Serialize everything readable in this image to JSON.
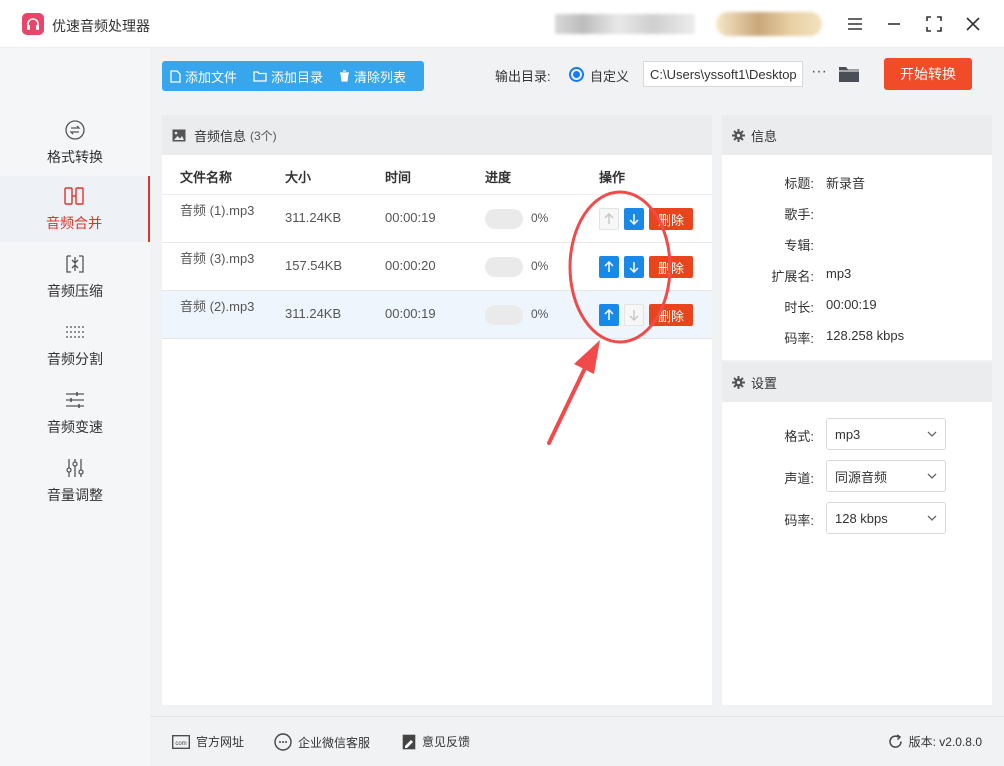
{
  "app": {
    "title": "优速音频处理器",
    "accent": "#e0332b",
    "logo_color": "#e8456b"
  },
  "sidebar": {
    "items": [
      {
        "label": "格式转换",
        "icon": "format-convert-icon",
        "active": false
      },
      {
        "label": "音频合并",
        "icon": "audio-merge-icon",
        "active": true
      },
      {
        "label": "音频压缩",
        "icon": "audio-compress-icon",
        "active": false
      },
      {
        "label": "音频分割",
        "icon": "audio-split-icon",
        "active": false
      },
      {
        "label": "音频变速",
        "icon": "audio-speed-icon",
        "active": false
      },
      {
        "label": "音量调整",
        "icon": "volume-adjust-icon",
        "active": false
      }
    ]
  },
  "toolbar": {
    "add_file": "添加文件",
    "add_dir": "添加目录",
    "clear_list": "清除列表",
    "output_label": "输出目录:",
    "output_option": "自定义",
    "output_path": "C:\\Users\\yssoft1\\Desktop",
    "more": "···",
    "start": "开始转换",
    "start_color": "#f04c27",
    "toolbar_color": "#37a6ec"
  },
  "audio_panel": {
    "title": "音频信息",
    "count": "(3个)",
    "columns": [
      "文件名称",
      "大小",
      "时间",
      "进度",
      "操作"
    ],
    "rows": [
      {
        "name": "音频 (1).mp3",
        "size": "311.24KB",
        "time": "00:00:19",
        "progress": 0,
        "progress_text": "0%",
        "up_enabled": false,
        "down_enabled": true,
        "selected": false
      },
      {
        "name": "音频 (3).mp3",
        "size": "157.54KB",
        "time": "00:00:20",
        "progress": 0,
        "progress_text": "0%",
        "up_enabled": true,
        "down_enabled": true,
        "selected": false
      },
      {
        "name": "音频 (2).mp3",
        "size": "311.24KB",
        "time": "00:00:19",
        "progress": 0,
        "progress_text": "0%",
        "up_enabled": true,
        "down_enabled": false,
        "selected": true
      }
    ],
    "delete_label": "删除"
  },
  "info": {
    "title": "信息",
    "fields": [
      {
        "key": "标题:",
        "value": "新录音"
      },
      {
        "key": "歌手:",
        "value": ""
      },
      {
        "key": "专辑:",
        "value": ""
      },
      {
        "key": "扩展名:",
        "value": "mp3"
      },
      {
        "key": "时长:",
        "value": "00:00:19"
      },
      {
        "key": "码率:",
        "value": "128.258 kbps"
      }
    ]
  },
  "settings": {
    "title": "设置",
    "fields": [
      {
        "key": "格式:",
        "value": "mp3"
      },
      {
        "key": "声道:",
        "value": "同源音频"
      },
      {
        "key": "码率:",
        "value": "128 kbps"
      }
    ]
  },
  "footer": {
    "website": "官方网址",
    "wechat": "企业微信客服",
    "feedback": "意见反馈",
    "version": "版本: v2.0.8.0"
  }
}
